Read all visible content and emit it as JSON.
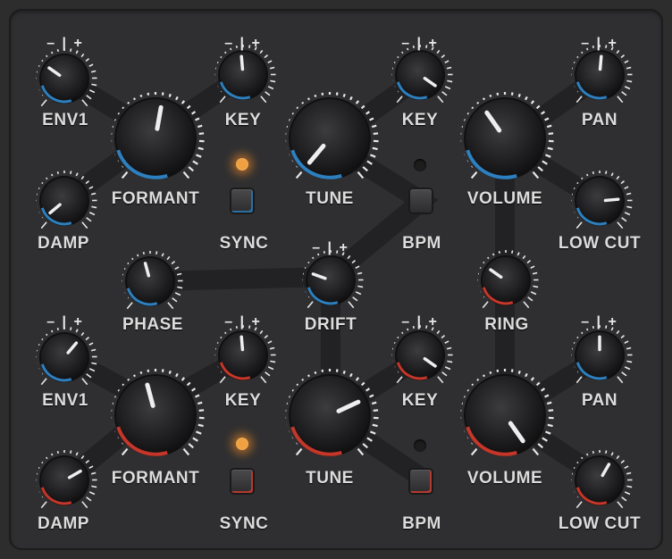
{
  "panel": {
    "colors": {
      "background": "#2f2f31",
      "accent_blue": "#2f86c8",
      "accent_red": "#d0392b",
      "led_on": "#f0a040"
    },
    "plus_minus": "– | +",
    "top_section": {
      "env1_label": "ENV1",
      "damp_label": "DAMP",
      "formant_label": "FORMANT",
      "key1_label": "KEY",
      "sync_label": "SYNC",
      "tune_label": "TUNE",
      "key2_label": "KEY",
      "bpm_label": "BPM",
      "volume_label": "VOLUME",
      "pan_label": "PAN",
      "lowcut_label": "LOW CUT"
    },
    "middle_section": {
      "phase_label": "PHASE",
      "drift_label": "DRIFT",
      "ring_label": "RING"
    },
    "bottom_section": {
      "env1_label": "ENV1",
      "damp_label": "DAMP",
      "formant_label": "FORMANT",
      "key1_label": "KEY",
      "sync_label": "SYNC",
      "tune_label": "TUNE",
      "key2_label": "KEY",
      "bpm_label": "BPM",
      "volume_label": "VOLUME",
      "pan_label": "PAN",
      "lowcut_label": "LOW CUT"
    },
    "leds": {
      "top_sync": "on",
      "top_bpm": "off",
      "bottom_sync": "on",
      "bottom_bpm": "off"
    }
  }
}
